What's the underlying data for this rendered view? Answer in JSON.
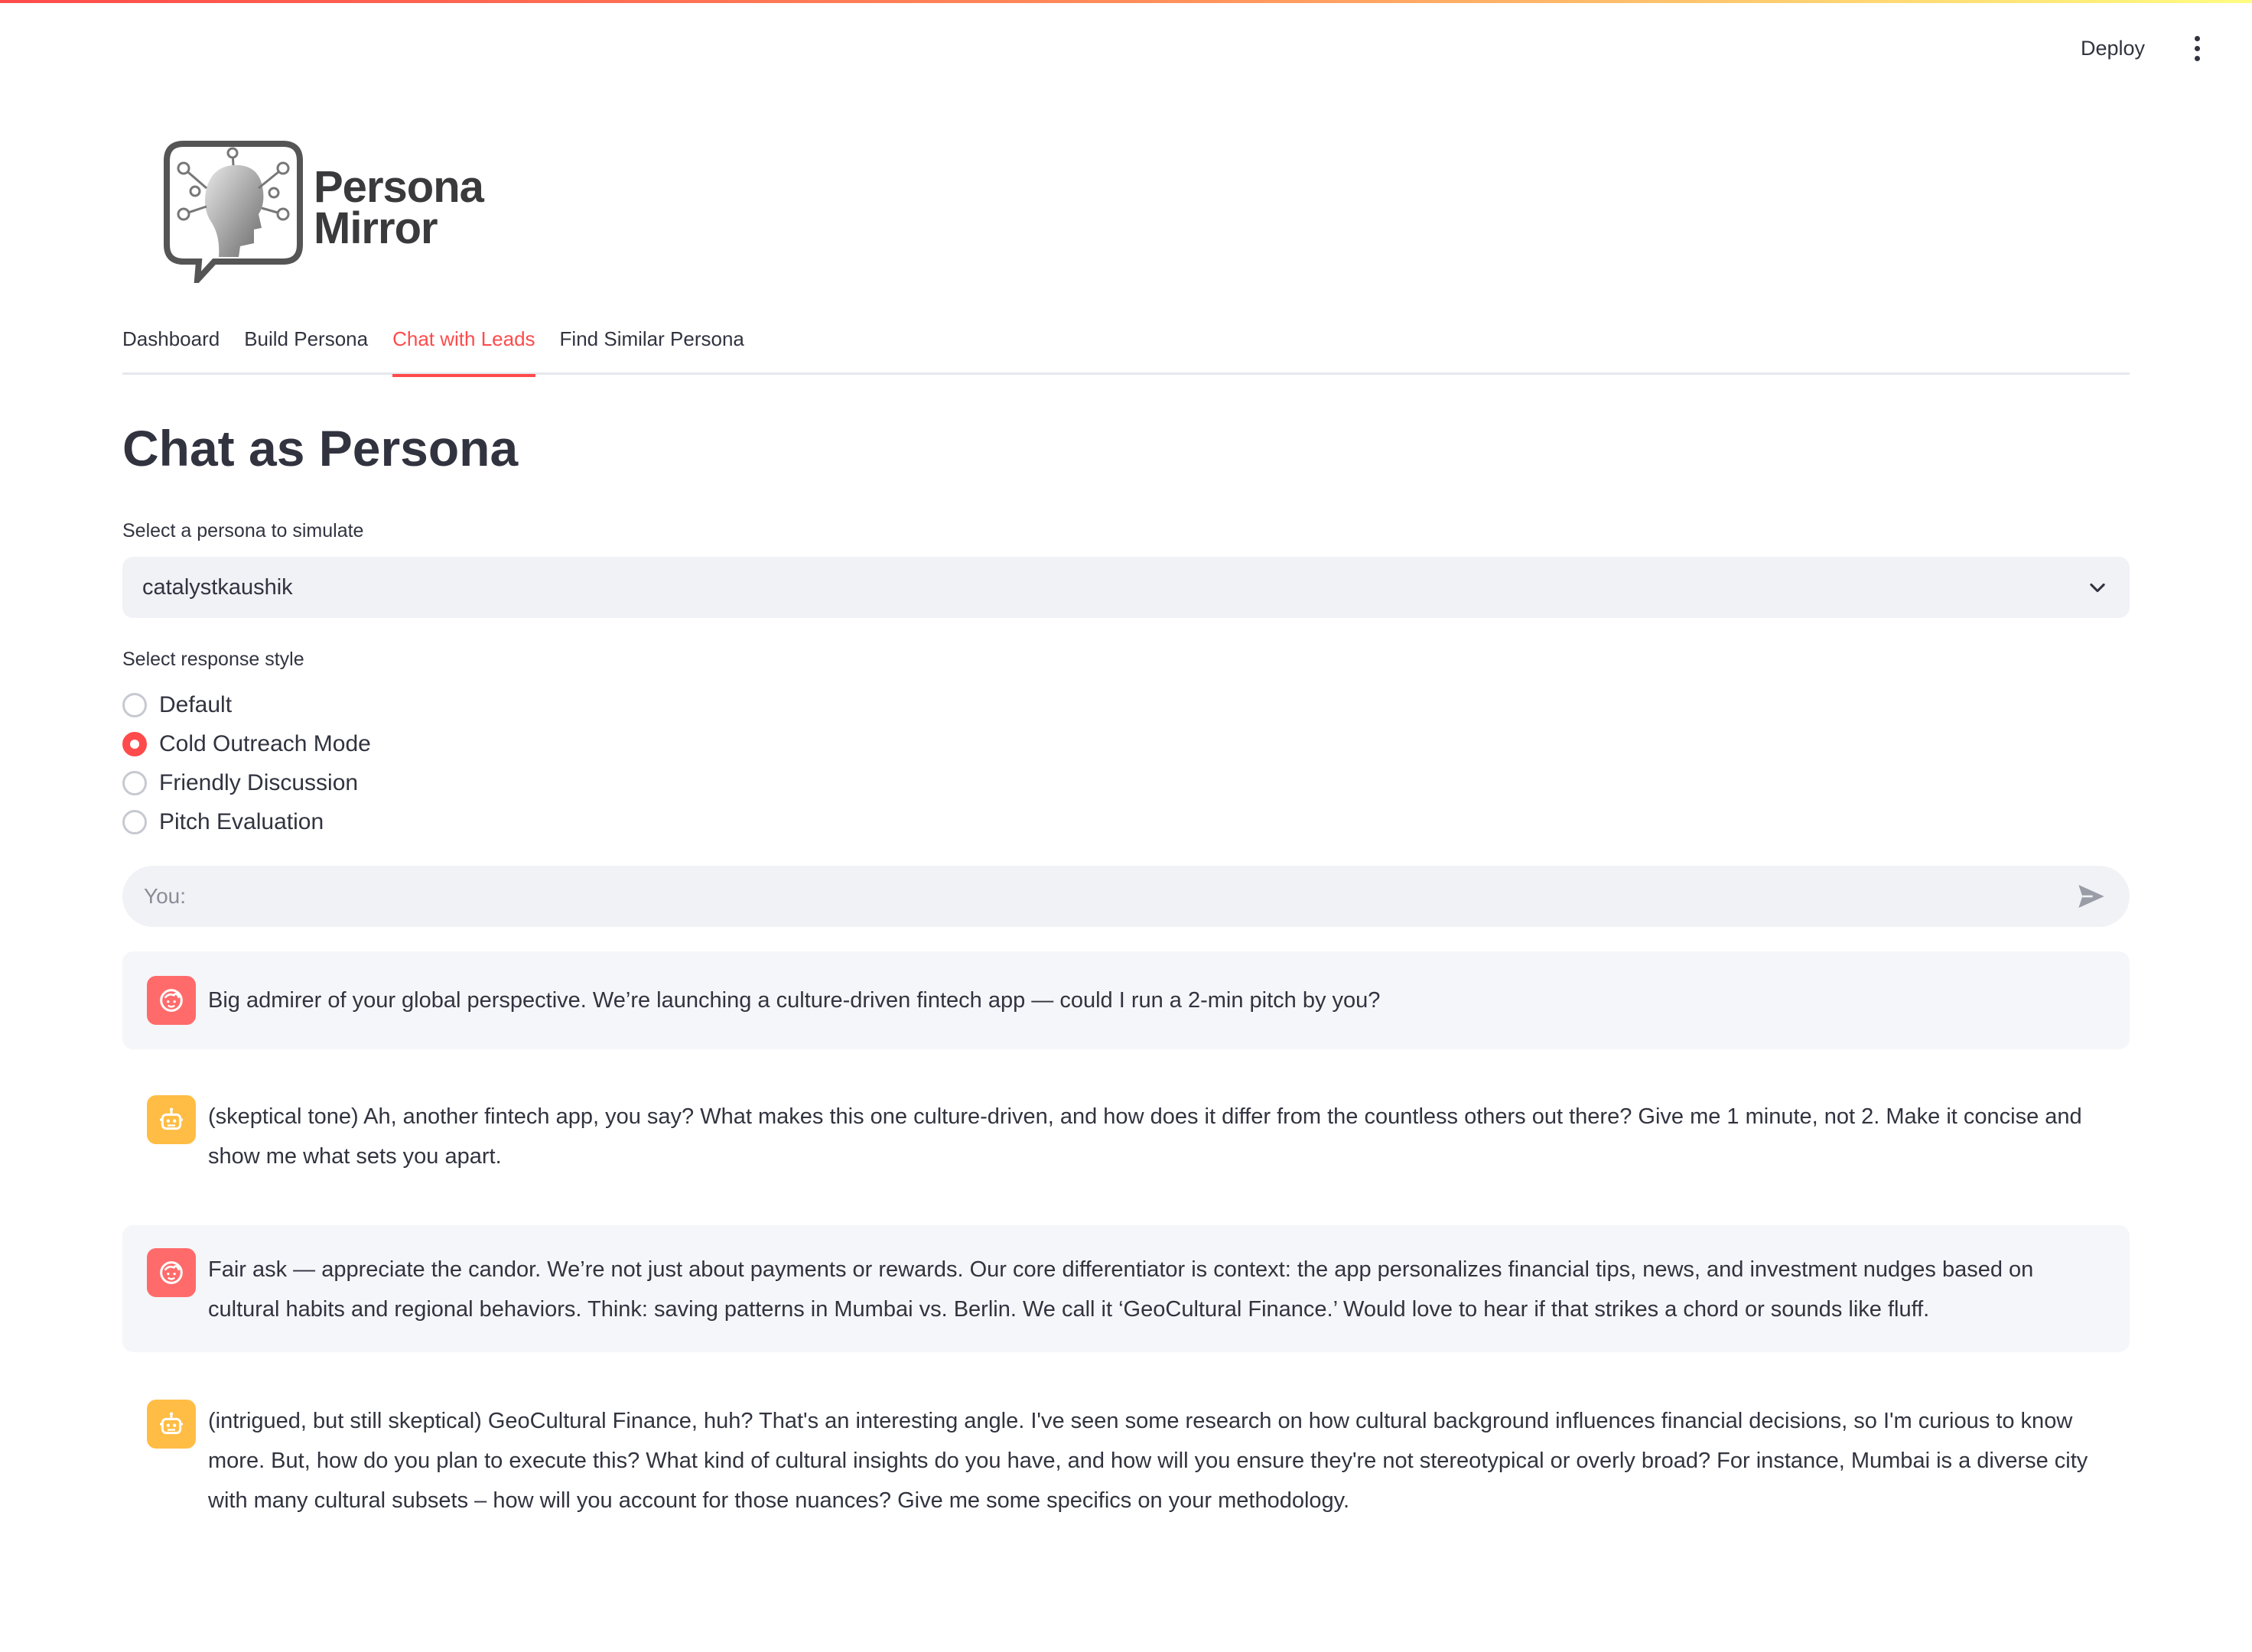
{
  "header": {
    "deploy_label": "Deploy",
    "menu_icon": "more-vertical-icon"
  },
  "logo": {
    "line1": "Persona",
    "line2": "Mirror"
  },
  "tabs": [
    {
      "label": "Dashboard",
      "active": false
    },
    {
      "label": "Build Persona",
      "active": false
    },
    {
      "label": "Chat with Leads",
      "active": true
    },
    {
      "label": "Find Similar Persona",
      "active": false
    }
  ],
  "page": {
    "title": "Chat as Persona"
  },
  "persona_select": {
    "label": "Select a persona to simulate",
    "value": "catalystkaushik"
  },
  "response_style": {
    "label": "Select response style",
    "options": [
      {
        "label": "Default",
        "selected": false
      },
      {
        "label": "Cold Outreach Mode",
        "selected": true
      },
      {
        "label": "Friendly Discussion",
        "selected": false
      },
      {
        "label": "Pitch Evaluation",
        "selected": false
      }
    ]
  },
  "chat_input": {
    "placeholder": "You:",
    "value": ""
  },
  "messages": [
    {
      "role": "user",
      "text": "Big admirer of your global perspective. We’re launching a culture-driven fintech app — could I run a 2-min pitch by you?"
    },
    {
      "role": "assistant",
      "text": "(skeptical tone) Ah, another fintech app, you say? What makes this one culture-driven, and how does it differ from the countless others out there? Give me 1 minute, not 2. Make it concise and show me what sets you apart."
    },
    {
      "role": "user",
      "text": "Fair ask — appreciate the candor. We’re not just about payments or rewards. Our core differentiator is context: the app personalizes financial tips, news, and investment nudges based on cultural habits and regional behaviors. Think: saving patterns in Mumbai vs. Berlin. We call it ‘GeoCultural Finance.’ Would love to hear if that strikes a chord or sounds like fluff."
    },
    {
      "role": "assistant",
      "text": "(intrigued, but still skeptical) GeoCultural Finance, huh? That's an interesting angle. I've seen some research on how cultural background influences financial decisions, so I'm curious to know more. But, how do you plan to execute this? What kind of cultural insights do you have, and how will you ensure they're not stereotypical or overly broad? For instance, Mumbai is a diverse city with many cultural subsets – how will you account for those nuances? Give me some specifics on your methodology."
    }
  ],
  "colors": {
    "accent": "#ff4b4b",
    "user_avatar": "#ff6b6b",
    "bot_avatar": "#ffbd45",
    "field_bg": "#f0f2f6"
  }
}
